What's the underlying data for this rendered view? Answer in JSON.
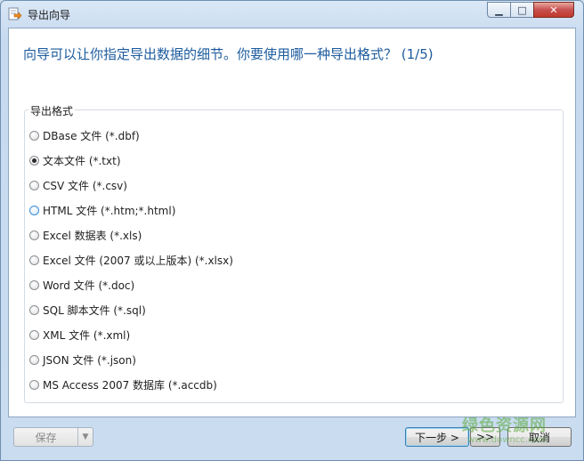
{
  "window": {
    "title": "导出向导",
    "app_icon": "export-wizard-icon",
    "controls": {
      "minimize": "minimize-icon",
      "maximize": "maximize-icon",
      "close": "close-icon"
    }
  },
  "main": {
    "heading": "向导可以让你指定导出数据的细节。你要使用哪一种导出格式？ (1/5)",
    "group_label": "导出格式",
    "selected_index": 1,
    "options": [
      {
        "label": "DBase 文件 (*.dbf)"
      },
      {
        "label": "文本文件 (*.txt)"
      },
      {
        "label": "CSV 文件 (*.csv)"
      },
      {
        "label": "HTML 文件 (*.htm;*.html)"
      },
      {
        "label": "Excel 数据表 (*.xls)"
      },
      {
        "label": "Excel 文件 (2007 或以上版本) (*.xlsx)"
      },
      {
        "label": "Word 文件 (*.doc)"
      },
      {
        "label": "SQL 脚本文件 (*.sql)"
      },
      {
        "label": "XML 文件 (*.xml)"
      },
      {
        "label": "JSON 文件 (*.json)"
      },
      {
        "label": "MS Access 2007 数据库 (*.accdb)"
      }
    ]
  },
  "footer": {
    "save_label": "保存",
    "next_label": "下一步 >",
    "last_label": ">>",
    "cancel_label": "取消"
  },
  "watermark": {
    "text": "绿色资源网",
    "sub": "www.downcc.com"
  },
  "colors": {
    "heading": "#1c5b9e",
    "frame": "#c9dcf0",
    "close": "#c75050"
  }
}
